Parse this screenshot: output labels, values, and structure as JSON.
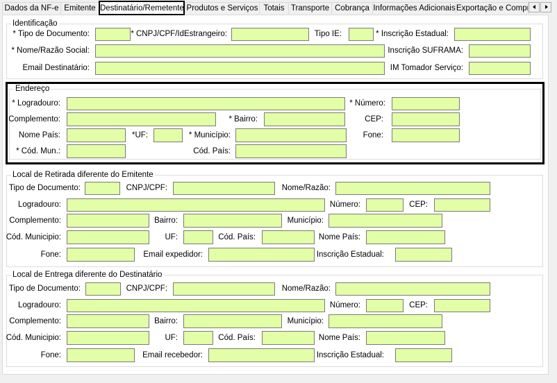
{
  "tabs": [
    "Dados da NF-e",
    "Emitente",
    "Destinatário/Remetente",
    "Produtos e Serviços",
    "Totais",
    "Transporte",
    "Cobrança",
    "Informações Adicionais",
    "Exportação e Compr"
  ],
  "selected_tab": "Destinatário/Remetente",
  "field_color": "#e2fea6",
  "identificacao": {
    "title": "Identificação",
    "tipo_documento": "* Tipo de Documento:",
    "cnpj": "* CNPJ/CPF/IdEstrangeiro:",
    "tipo_ie": "Tipo IE:",
    "inscricao_estadual": "* Inscrição Estadual:",
    "nome": "* Nome/Razão Social:",
    "suframa": "Inscrição SUFRAMA:",
    "email": "Email Destinatário:",
    "im_tomador": "IM Tomador Serviço:"
  },
  "endereco": {
    "title": "Endereço",
    "logradouro": "* Logradouro:",
    "numero": "* Número:",
    "complemento": "Complemento:",
    "bairro": "* Bairro:",
    "cep": "CEP:",
    "nome_pais": "Nome País:",
    "uf": "*UF:",
    "municipio": "* Município:",
    "fone": "Fone:",
    "cod_mun": "* Cód. Mun.:",
    "cod_pais": "Cód. País:"
  },
  "retirada": {
    "title": "Local de Retirada diferente do Emitente",
    "tipo_documento": "Tipo de Documento:",
    "cnpj": "CNPJ/CPF:",
    "nome": "Nome/Razão:",
    "logradouro": "Logradouro:",
    "numero": "Número:",
    "cep": "CEP:",
    "complemento": "Complemento:",
    "bairro": "Bairro:",
    "municipio": "Município:",
    "cod_municipio": "Cód. Municipio:",
    "uf": "UF:",
    "cod_pais": "Cód. País:",
    "nome_pais": "Nome País:",
    "fone": "Fone:",
    "email": "Email expedidor:",
    "inscricao_estadual": "Inscrição Estadual:"
  },
  "entrega": {
    "title": "Local de Entrega diferente do Destinatário",
    "tipo_documento": "Tipo de Documento:",
    "cnpj": "CNPJ/CPF:",
    "nome": "Nome/Razão:",
    "logradouro": "Logradouro:",
    "numero": "Número:",
    "cep": "CEP:",
    "complemento": "Complemento:",
    "bairro": "Bairro:",
    "municipio": "Município:",
    "cod_municipio": "Cód. Municipio:",
    "uf": "UF:",
    "cod_pais": "Cód. País:",
    "nome_pais": "Nome País:",
    "fone": "Fone:",
    "email": "Email recebedor:",
    "inscricao_estadual": "Inscrição Estadual:"
  }
}
